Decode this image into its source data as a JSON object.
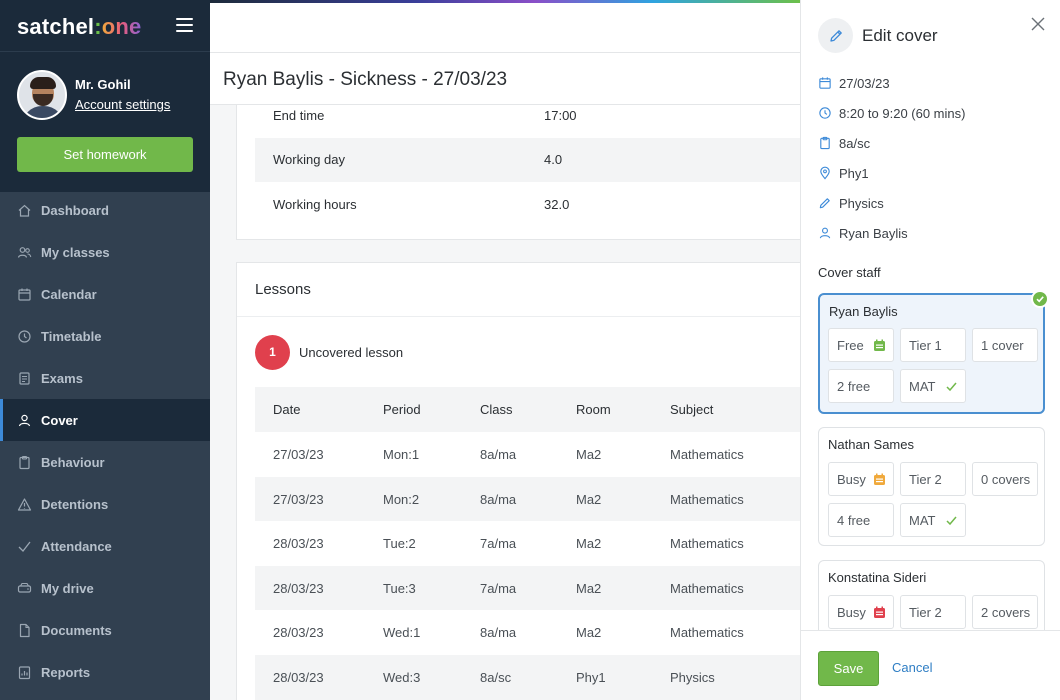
{
  "brand": {
    "name_part1": "satchel",
    "name_colon": ":",
    "name_part2": "one"
  },
  "user": {
    "name": "Mr. Gohil",
    "account_link": "Account settings"
  },
  "sidebar": {
    "primary_action": "Set homework",
    "items": [
      {
        "label": "Dashboard",
        "icon": "home-icon",
        "active": false
      },
      {
        "label": "My classes",
        "icon": "users-icon",
        "active": false
      },
      {
        "label": "Calendar",
        "icon": "calendar-icon",
        "active": false
      },
      {
        "label": "Timetable",
        "icon": "clock-icon",
        "active": false
      },
      {
        "label": "Exams",
        "icon": "exam-icon",
        "active": false
      },
      {
        "label": "Cover",
        "icon": "person-icon",
        "active": true
      },
      {
        "label": "Behaviour",
        "icon": "clipboard-icon",
        "active": false
      },
      {
        "label": "Detentions",
        "icon": "warning-icon",
        "active": false
      },
      {
        "label": "Attendance",
        "icon": "check-icon",
        "active": false
      },
      {
        "label": "My drive",
        "icon": "drive-icon",
        "active": false
      },
      {
        "label": "Documents",
        "icon": "document-icon",
        "active": false
      },
      {
        "label": "Reports",
        "icon": "report-icon",
        "active": false
      }
    ]
  },
  "main": {
    "title": "Ryan Baylis - Sickness - 27/03/23",
    "details": [
      {
        "key": "End time",
        "value": "17:00"
      },
      {
        "key": "Working day",
        "value": "4.0"
      },
      {
        "key": "Working hours",
        "value": "32.0"
      }
    ],
    "lessons": {
      "title": "Lessons",
      "uncovered_count": "1",
      "uncovered_label": "Uncovered lesson",
      "columns": [
        "Date",
        "Period",
        "Class",
        "Room",
        "Subject"
      ],
      "rows": [
        [
          "27/03/23",
          "Mon:1",
          "8a/ma",
          "Ma2",
          "Mathematics"
        ],
        [
          "27/03/23",
          "Mon:2",
          "8a/ma",
          "Ma2",
          "Mathematics"
        ],
        [
          "28/03/23",
          "Tue:2",
          "7a/ma",
          "Ma2",
          "Mathematics"
        ],
        [
          "28/03/23",
          "Tue:3",
          "7a/ma",
          "Ma2",
          "Mathematics"
        ],
        [
          "28/03/23",
          "Wed:1",
          "8a/ma",
          "Ma2",
          "Mathematics"
        ],
        [
          "28/03/23",
          "Wed:3",
          "8a/sc",
          "Phy1",
          "Physics"
        ]
      ]
    }
  },
  "panel": {
    "title": "Edit cover",
    "info": [
      {
        "icon": "calendar-icon",
        "text": "27/03/23"
      },
      {
        "icon": "clock-icon",
        "text": "8:20 to 9:20 (60 mins)"
      },
      {
        "icon": "clipboard-icon",
        "text": "8a/sc"
      },
      {
        "icon": "location-pin-icon",
        "text": "Phy1"
      },
      {
        "icon": "pencil-icon",
        "text": "Physics"
      },
      {
        "icon": "person-icon",
        "text": "Ryan Baylis"
      }
    ],
    "cover_staff_label": "Cover staff",
    "staff": [
      {
        "name": "Ryan Baylis",
        "selected": true,
        "status": "Free",
        "status_color": "#71b84a",
        "tier": "Tier 1",
        "covers": "1 cover",
        "free": "2 free",
        "subject": "MAT"
      },
      {
        "name": "Nathan Sames",
        "selected": false,
        "status": "Busy",
        "status_color": "#f0a93c",
        "tier": "Tier 2",
        "covers": "0 covers",
        "free": "4 free",
        "subject": "MAT"
      },
      {
        "name": "Konstatina Sideri",
        "selected": false,
        "status": "Busy",
        "status_color": "#e0404d",
        "tier": "Tier 2",
        "covers": "2 covers"
      }
    ],
    "save_label": "Save",
    "cancel_label": "Cancel"
  },
  "colors": {
    "accent_green": "#71b84a",
    "sidebar_bg": "#314050",
    "link_blue": "#2f7ec4",
    "alert_red": "#e0404d"
  }
}
